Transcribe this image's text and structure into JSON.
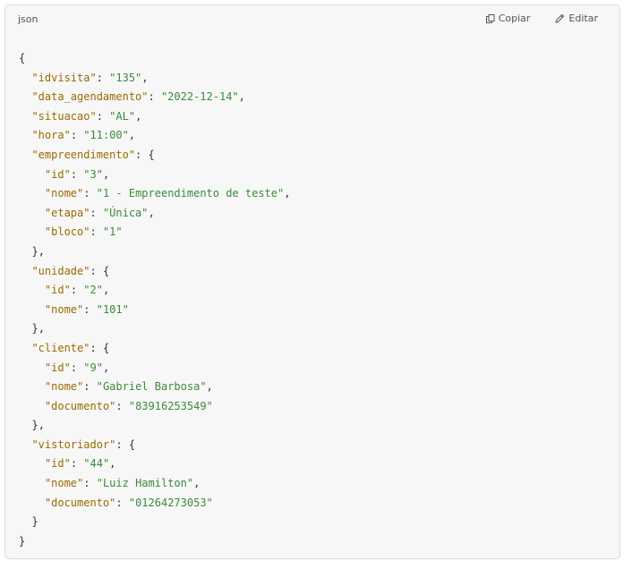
{
  "header": {
    "language": "json",
    "copy_label": "Copiar",
    "edit_label": "Editar",
    "copy_icon": "copy-icon",
    "edit_icon": "pencil-icon"
  },
  "colors": {
    "key": "#9a6a00",
    "string": "#3a8a3a",
    "punctuation": "#333333",
    "background": "#f7f7f7"
  },
  "code": {
    "idvisita": "135",
    "data_agendamento": "2022-12-14",
    "situacao": "AL",
    "hora": "11:00",
    "empreendimento": {
      "id": "3",
      "nome": "1 - Empreendimento de teste",
      "etapa": "Única",
      "bloco": "1"
    },
    "unidade": {
      "id": "2",
      "nome": "101"
    },
    "cliente": {
      "id": "9",
      "nome": "Gabriel Barbosa",
      "documento": "83916253549"
    },
    "vistoriador": {
      "id": "44",
      "nome": "Luiz Hamilton",
      "documento": "01264273053"
    }
  }
}
